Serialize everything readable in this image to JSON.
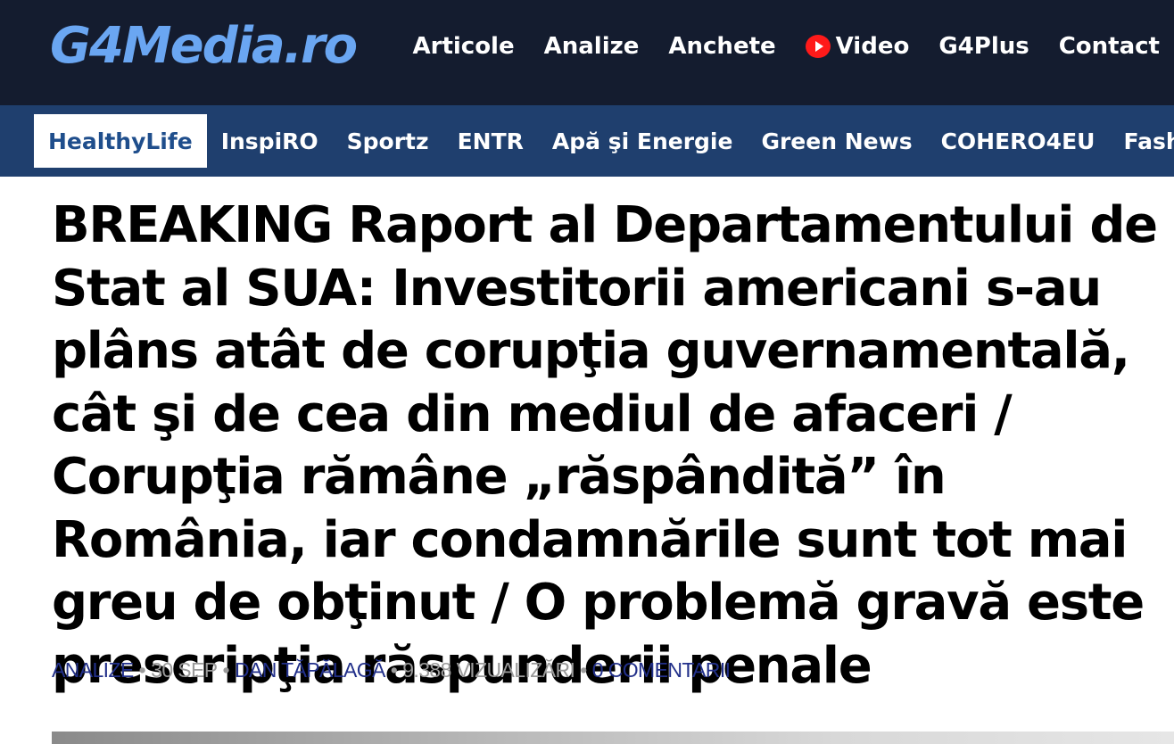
{
  "header": {
    "logo_text": "G4Media.ro",
    "nav": [
      "Articole",
      "Analize",
      "Anchete",
      "Video",
      "G4Plus",
      "Contact"
    ],
    "video_icon": "youtube-play-icon"
  },
  "subnav": {
    "active": "HealthyLife",
    "items": [
      "HealthyLife",
      "InspiRO",
      "Sportz",
      "ENTR",
      "Apă şi Energie",
      "Green News",
      "COHERO4EU",
      "Fashio"
    ]
  },
  "article": {
    "headline": "BREAKING Raport al Departamentului de Stat al SUA: Investitorii americani s-au plâns atât de corupţia guvernamentală, cât şi de cea din mediul de afaceri / Corupţia rămâne „răspândită” în România, iar condamnările sunt tot mai greu de obţinut / O problemă gravă este prescripţia răspunderii penale",
    "meta": {
      "category": "ANALIZE",
      "date": "30 SEP",
      "author": "DAN TĂPĂLAGĂ",
      "views": "9.388 VIZUALIZĂRI",
      "comments": "0 COMENTARII"
    }
  },
  "colors": {
    "topbar_bg": "#141c2f",
    "subbar_bg": "#1f3f6e",
    "logo": "#6aa6f2",
    "active_tab_text": "#1f4e8c",
    "meta_link": "#22308a",
    "meta_muted": "#9a9a9a"
  }
}
